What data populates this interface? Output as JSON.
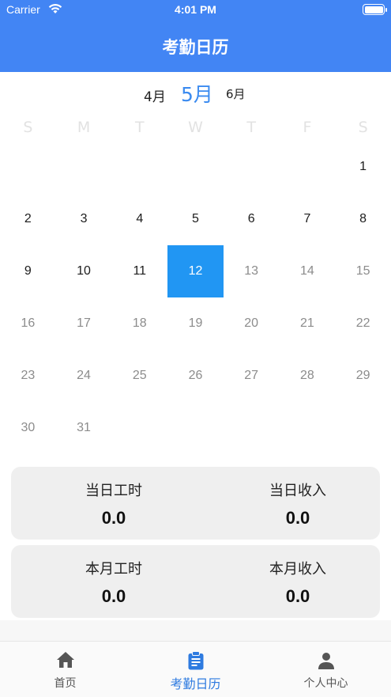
{
  "status_bar": {
    "carrier": "Carrier",
    "time": "4:01 PM",
    "wifi_icon": "wifi-icon",
    "battery_icon": "battery-icon"
  },
  "header": {
    "title": "考勤日历",
    "background": "#4285f4"
  },
  "month_nav": {
    "prev": "4月",
    "current": "5月",
    "next": "6月"
  },
  "weekdays": [
    "S",
    "M",
    "T",
    "W",
    "T",
    "F",
    "S"
  ],
  "calendar": {
    "first_weekday_index": 6,
    "days": [
      "1",
      "2",
      "3",
      "4",
      "5",
      "6",
      "7",
      "8",
      "9",
      "10",
      "11",
      "12",
      "13",
      "14",
      "15",
      "16",
      "17",
      "18",
      "19",
      "20",
      "21",
      "22",
      "23",
      "24",
      "25",
      "26",
      "27",
      "28",
      "29",
      "30",
      "31"
    ],
    "selected_day": 12,
    "selected_color": "#2196f3"
  },
  "daily": {
    "hours_label": "当日工时",
    "hours_value": "0.0",
    "income_label": "当日收入",
    "income_value": "0.0"
  },
  "monthly": {
    "hours_label": "本月工时",
    "hours_value": "0.0",
    "income_label": "本月收入",
    "income_value": "0.0"
  },
  "tabbar": {
    "home": {
      "label": "首页",
      "icon": "home-icon"
    },
    "calendar": {
      "label": "考勤日历",
      "icon": "clipboard-icon",
      "active": true
    },
    "profile": {
      "label": "个人中心",
      "icon": "person-icon"
    },
    "active_color": "#2e7be0"
  }
}
